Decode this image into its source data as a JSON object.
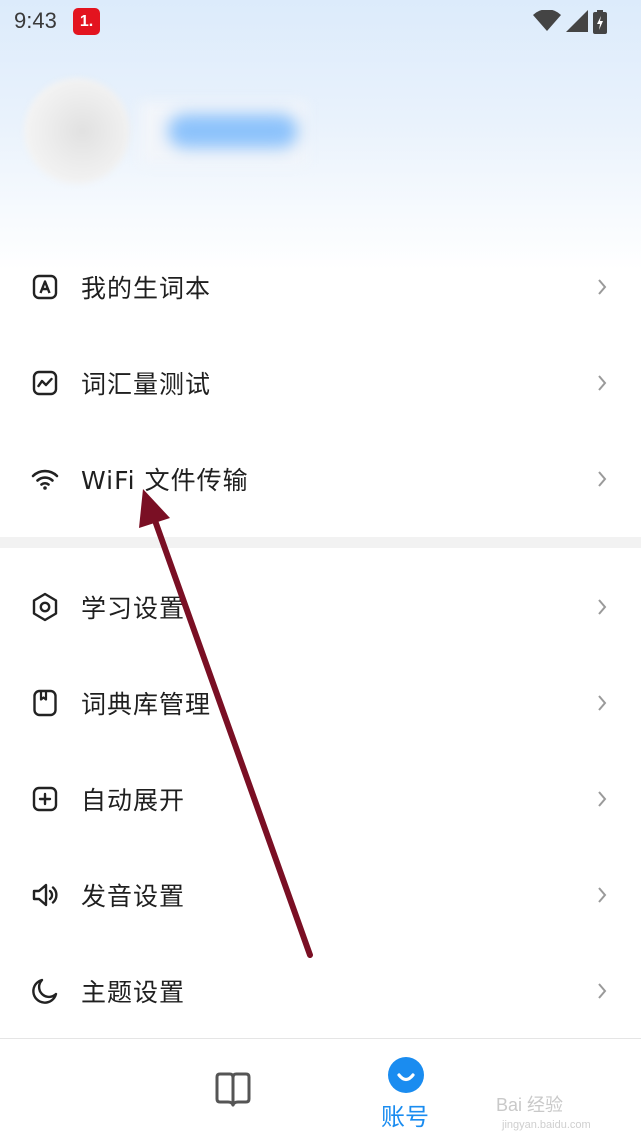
{
  "status_bar": {
    "time": "9:43",
    "badge": "1."
  },
  "profile": {
    "avatar": "avatar",
    "username": ""
  },
  "menu": {
    "group1": [
      {
        "label": "我的生词本",
        "icon": "letter-a-square-icon"
      },
      {
        "label": "词汇量测试",
        "icon": "line-chart-square-icon"
      },
      {
        "label": "WiFi 文件传输",
        "icon": "wifi-icon"
      }
    ],
    "group2": [
      {
        "label": "学习设置",
        "icon": "hexagon-settings-icon"
      },
      {
        "label": "词典库管理",
        "icon": "dictionary-icon"
      },
      {
        "label": "自动展开",
        "icon": "plus-square-icon"
      },
      {
        "label": "发音设置",
        "icon": "speaker-icon"
      },
      {
        "label": "主题设置",
        "icon": "moon-icon"
      }
    ]
  },
  "bottom_nav": {
    "tabs": [
      {
        "label": "",
        "icon": "book-icon"
      },
      {
        "label": "账号",
        "icon": "account-icon",
        "active": true
      }
    ]
  },
  "watermark": {
    "text": "Bai 经验",
    "sub": "jingyan.baidu.com"
  },
  "colors": {
    "accent": "#1a8cf0",
    "annotation": "#7a0f24",
    "badge": "#e3141f"
  }
}
